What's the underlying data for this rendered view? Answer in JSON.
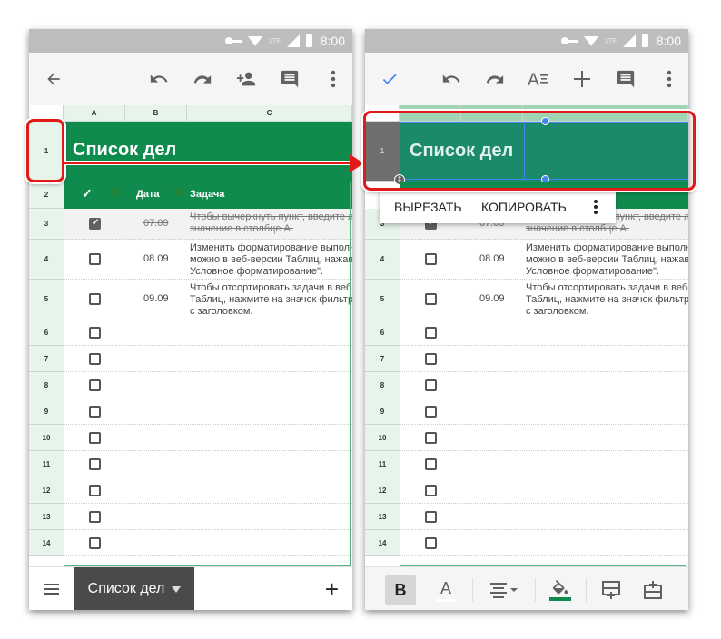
{
  "status_bar": {
    "time": "8:00",
    "network": "LTE",
    "icons": [
      "vpn-key-icon",
      "wifi-icon",
      "lte-icon",
      "signal-icon",
      "battery-icon"
    ]
  },
  "left_screen": {
    "toolbar": {
      "back": "back-arrow-icon",
      "undo": "undo-icon",
      "redo": "redo-icon",
      "share": "add-person-icon",
      "comment": "comment-icon",
      "more": "more-vert-icon"
    },
    "columns": [
      "A",
      "B",
      "C"
    ],
    "title": "Список дел",
    "header_row": {
      "check": "✓",
      "date": "Дата",
      "task": "Задача"
    },
    "rows": [
      {
        "num": "3",
        "checked": true,
        "date": "07.09",
        "task": [
          "Чтобы вычеркнуть пункт, введите л",
          "значение в столбце А."
        ],
        "strike": true
      },
      {
        "num": "4",
        "checked": false,
        "date": "08.09",
        "task": [
          "Изменить форматирование выполн",
          "можно в веб-версии Таблиц, нажав",
          "Условное форматирование\"."
        ],
        "strike": false
      },
      {
        "num": "5",
        "checked": false,
        "date": "09.09",
        "task": [
          "Чтобы отсортировать задачи в веб-",
          "Таблиц, нажмите на значок фильтр",
          "с заголовком."
        ],
        "strike": false
      },
      {
        "num": "6",
        "checked": false
      },
      {
        "num": "7",
        "checked": false
      },
      {
        "num": "8",
        "checked": false
      },
      {
        "num": "9",
        "checked": false
      },
      {
        "num": "10",
        "checked": false
      },
      {
        "num": "11",
        "checked": false
      },
      {
        "num": "12",
        "checked": false
      },
      {
        "num": "13",
        "checked": false
      },
      {
        "num": "14",
        "checked": false
      }
    ],
    "row_header_1": "1",
    "row_header_2": "2",
    "bottom": {
      "sheet_tab": "Список дел",
      "add": "+"
    }
  },
  "right_screen": {
    "toolbar": {
      "done": "check-icon",
      "undo": "undo-icon",
      "redo": "redo-icon",
      "text_format": "text-format-icon",
      "insert": "plus-icon",
      "comment": "comment-icon",
      "more": "more-vert-icon"
    },
    "title": "Список дел",
    "row_header_1": "1",
    "context_menu": {
      "cut": "ВЫРЕЗАТЬ",
      "copy": "КОПИРОВАТЬ"
    },
    "format_bar": {
      "bold": "B",
      "text_color": "A",
      "fill_color": "#0f8b4e"
    }
  },
  "colors": {
    "accent_green": "#0f8b4e",
    "highlight_red": "#e01919",
    "selection_blue": "#4285f4"
  }
}
